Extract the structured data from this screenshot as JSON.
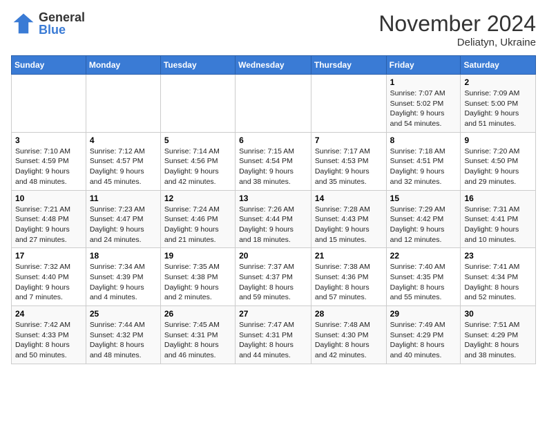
{
  "logo": {
    "general": "General",
    "blue": "Blue"
  },
  "header": {
    "month": "November 2024",
    "location": "Deliatyn, Ukraine"
  },
  "weekdays": [
    "Sunday",
    "Monday",
    "Tuesday",
    "Wednesday",
    "Thursday",
    "Friday",
    "Saturday"
  ],
  "weeks": [
    [
      {
        "day": "",
        "info": ""
      },
      {
        "day": "",
        "info": ""
      },
      {
        "day": "",
        "info": ""
      },
      {
        "day": "",
        "info": ""
      },
      {
        "day": "",
        "info": ""
      },
      {
        "day": "1",
        "info": "Sunrise: 7:07 AM\nSunset: 5:02 PM\nDaylight: 9 hours and 54 minutes."
      },
      {
        "day": "2",
        "info": "Sunrise: 7:09 AM\nSunset: 5:00 PM\nDaylight: 9 hours and 51 minutes."
      }
    ],
    [
      {
        "day": "3",
        "info": "Sunrise: 7:10 AM\nSunset: 4:59 PM\nDaylight: 9 hours and 48 minutes."
      },
      {
        "day": "4",
        "info": "Sunrise: 7:12 AM\nSunset: 4:57 PM\nDaylight: 9 hours and 45 minutes."
      },
      {
        "day": "5",
        "info": "Sunrise: 7:14 AM\nSunset: 4:56 PM\nDaylight: 9 hours and 42 minutes."
      },
      {
        "day": "6",
        "info": "Sunrise: 7:15 AM\nSunset: 4:54 PM\nDaylight: 9 hours and 38 minutes."
      },
      {
        "day": "7",
        "info": "Sunrise: 7:17 AM\nSunset: 4:53 PM\nDaylight: 9 hours and 35 minutes."
      },
      {
        "day": "8",
        "info": "Sunrise: 7:18 AM\nSunset: 4:51 PM\nDaylight: 9 hours and 32 minutes."
      },
      {
        "day": "9",
        "info": "Sunrise: 7:20 AM\nSunset: 4:50 PM\nDaylight: 9 hours and 29 minutes."
      }
    ],
    [
      {
        "day": "10",
        "info": "Sunrise: 7:21 AM\nSunset: 4:48 PM\nDaylight: 9 hours and 27 minutes."
      },
      {
        "day": "11",
        "info": "Sunrise: 7:23 AM\nSunset: 4:47 PM\nDaylight: 9 hours and 24 minutes."
      },
      {
        "day": "12",
        "info": "Sunrise: 7:24 AM\nSunset: 4:46 PM\nDaylight: 9 hours and 21 minutes."
      },
      {
        "day": "13",
        "info": "Sunrise: 7:26 AM\nSunset: 4:44 PM\nDaylight: 9 hours and 18 minutes."
      },
      {
        "day": "14",
        "info": "Sunrise: 7:28 AM\nSunset: 4:43 PM\nDaylight: 9 hours and 15 minutes."
      },
      {
        "day": "15",
        "info": "Sunrise: 7:29 AM\nSunset: 4:42 PM\nDaylight: 9 hours and 12 minutes."
      },
      {
        "day": "16",
        "info": "Sunrise: 7:31 AM\nSunset: 4:41 PM\nDaylight: 9 hours and 10 minutes."
      }
    ],
    [
      {
        "day": "17",
        "info": "Sunrise: 7:32 AM\nSunset: 4:40 PM\nDaylight: 9 hours and 7 minutes."
      },
      {
        "day": "18",
        "info": "Sunrise: 7:34 AM\nSunset: 4:39 PM\nDaylight: 9 hours and 4 minutes."
      },
      {
        "day": "19",
        "info": "Sunrise: 7:35 AM\nSunset: 4:38 PM\nDaylight: 9 hours and 2 minutes."
      },
      {
        "day": "20",
        "info": "Sunrise: 7:37 AM\nSunset: 4:37 PM\nDaylight: 8 hours and 59 minutes."
      },
      {
        "day": "21",
        "info": "Sunrise: 7:38 AM\nSunset: 4:36 PM\nDaylight: 8 hours and 57 minutes."
      },
      {
        "day": "22",
        "info": "Sunrise: 7:40 AM\nSunset: 4:35 PM\nDaylight: 8 hours and 55 minutes."
      },
      {
        "day": "23",
        "info": "Sunrise: 7:41 AM\nSunset: 4:34 PM\nDaylight: 8 hours and 52 minutes."
      }
    ],
    [
      {
        "day": "24",
        "info": "Sunrise: 7:42 AM\nSunset: 4:33 PM\nDaylight: 8 hours and 50 minutes."
      },
      {
        "day": "25",
        "info": "Sunrise: 7:44 AM\nSunset: 4:32 PM\nDaylight: 8 hours and 48 minutes."
      },
      {
        "day": "26",
        "info": "Sunrise: 7:45 AM\nSunset: 4:31 PM\nDaylight: 8 hours and 46 minutes."
      },
      {
        "day": "27",
        "info": "Sunrise: 7:47 AM\nSunset: 4:31 PM\nDaylight: 8 hours and 44 minutes."
      },
      {
        "day": "28",
        "info": "Sunrise: 7:48 AM\nSunset: 4:30 PM\nDaylight: 8 hours and 42 minutes."
      },
      {
        "day": "29",
        "info": "Sunrise: 7:49 AM\nSunset: 4:29 PM\nDaylight: 8 hours and 40 minutes."
      },
      {
        "day": "30",
        "info": "Sunrise: 7:51 AM\nSunset: 4:29 PM\nDaylight: 8 hours and 38 minutes."
      }
    ]
  ]
}
